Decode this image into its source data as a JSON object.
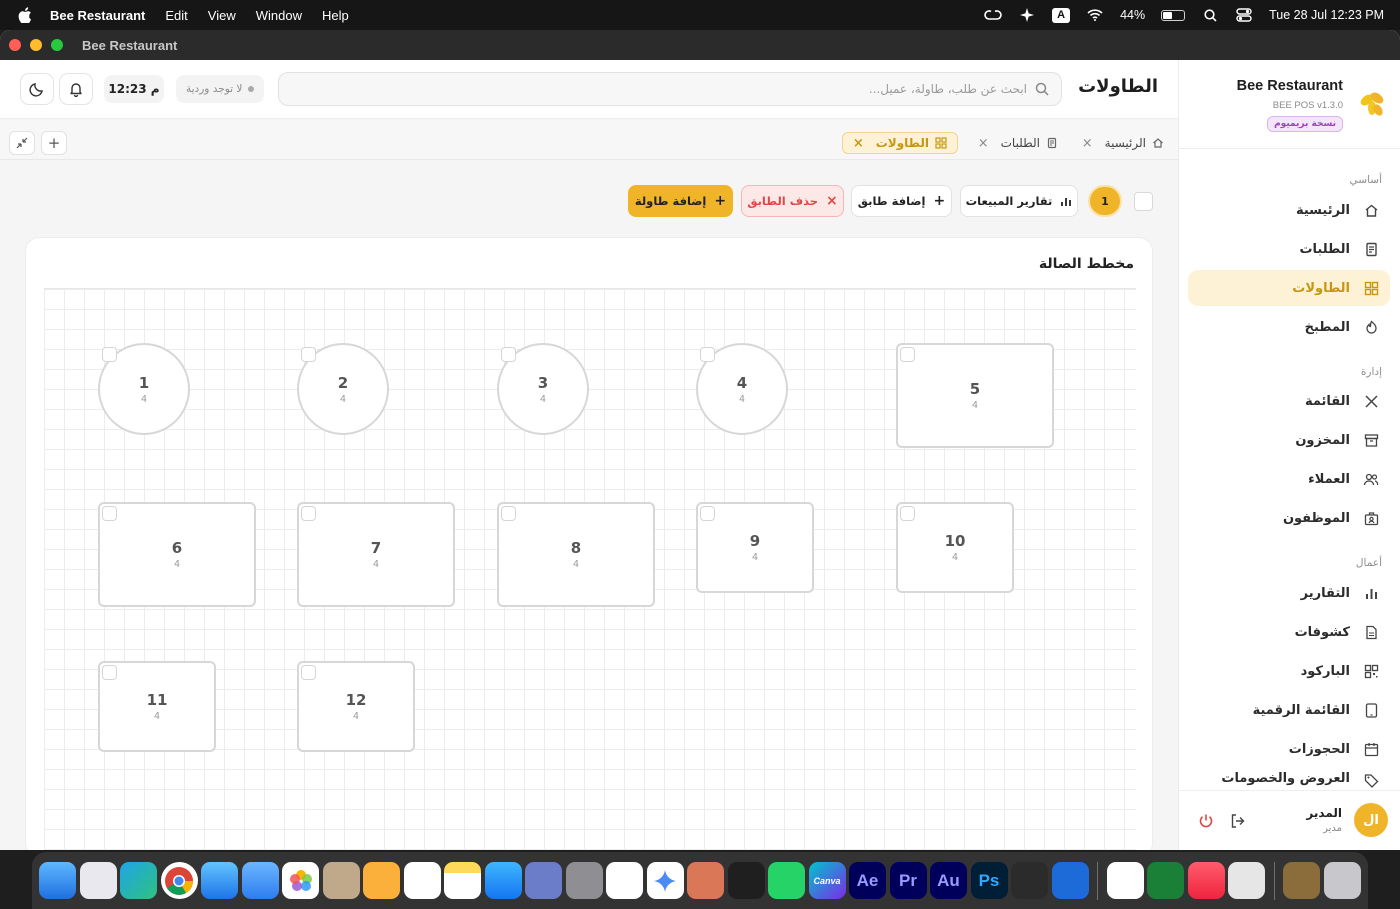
{
  "menubar": {
    "app": "Bee Restaurant",
    "items": [
      "Edit",
      "View",
      "Window",
      "Help"
    ],
    "battery": "44%",
    "datetime": "Tue 28 Jul  12:23 PM",
    "kbd": "A"
  },
  "window": {
    "title": "Bee Restaurant"
  },
  "sidebar": {
    "brand_name": "Bee Restaurant",
    "version": "BEE POS v1.3.0",
    "premium": "نسخة بريميوم",
    "sections": {
      "basic": "أساسي",
      "admin": "إدارة",
      "business": "أعمال"
    },
    "items": [
      {
        "label": "الرئيسية",
        "icon": "home-icon"
      },
      {
        "label": "الطلبات",
        "icon": "receipt-icon"
      },
      {
        "label": "الطاولات",
        "icon": "grid-icon",
        "active": true
      },
      {
        "label": "المطبخ",
        "icon": "chef-icon"
      },
      {
        "label": "القائمة",
        "icon": "utensils-icon"
      },
      {
        "label": "المخزون",
        "icon": "archive-icon"
      },
      {
        "label": "العملاء",
        "icon": "users-icon"
      },
      {
        "label": "الموظفون",
        "icon": "id-badge-icon"
      },
      {
        "label": "التقارير",
        "icon": "bar-chart-icon"
      },
      {
        "label": "كشوفات",
        "icon": "file-icon"
      },
      {
        "label": "الباركود",
        "icon": "qr-icon"
      },
      {
        "label": "القائمة الرقمية",
        "icon": "tablet-icon"
      },
      {
        "label": "الحجوزات",
        "icon": "calendar-icon"
      },
      {
        "label": "العروض والخصومات",
        "icon": "tag-icon"
      }
    ],
    "user": {
      "initials": "ال",
      "name": "المدير",
      "role": "مدير"
    }
  },
  "header": {
    "title": "الطاولات",
    "search_placeholder": "ابحث عن طلب، طاولة، عميل...",
    "shift": "لا توجد وردية",
    "clock": "12:23 م"
  },
  "tabs": [
    {
      "label": "الرئيسية"
    },
    {
      "label": "الطلبات"
    },
    {
      "label": "الطاولات",
      "active": true
    }
  ],
  "toolbar": {
    "sales_reports": "تقارير المبيعات",
    "add_floor": "إضافة طابق",
    "delete_floor": "حذف الطابق",
    "add_table": "إضافة طاولة",
    "floor": "1"
  },
  "floor_plan": {
    "title": "مخطط الصالة",
    "tables": [
      {
        "number": "1",
        "seats": "4",
        "shape": "round"
      },
      {
        "number": "2",
        "seats": "4",
        "shape": "round"
      },
      {
        "number": "3",
        "seats": "4",
        "shape": "round"
      },
      {
        "number": "4",
        "seats": "4",
        "shape": "round"
      },
      {
        "number": "5",
        "seats": "4",
        "shape": "rect"
      },
      {
        "number": "6",
        "seats": "4",
        "shape": "rect"
      },
      {
        "number": "7",
        "seats": "4",
        "shape": "rect"
      },
      {
        "number": "8",
        "seats": "4",
        "shape": "rect"
      },
      {
        "number": "9",
        "seats": "4",
        "shape": "rect"
      },
      {
        "number": "10",
        "seats": "4",
        "shape": "rect"
      },
      {
        "number": "11",
        "seats": "4",
        "shape": "rect"
      },
      {
        "number": "12",
        "seats": "4",
        "shape": "rect"
      }
    ]
  },
  "dock": {
    "apps": [
      "Finder",
      "Launchpad",
      "Edge",
      "Chrome",
      "Safari",
      "Mail",
      "Photos",
      "Contacts",
      "Pages",
      "Reminders",
      "Notes",
      "App Store",
      "Simulator",
      "System Settings",
      "ChatGPT",
      "Gemini",
      "Claude",
      "VS Code",
      "WhatsApp",
      "Canva",
      "Ae",
      "Pr",
      "Au",
      "Ps",
      "DaVinci",
      "QuickTime",
      "Calendar",
      "Numbers",
      "Music",
      "Bee",
      "Archive",
      "Trash"
    ],
    "canva": "Canva",
    "ae": "Ae",
    "pr": "Pr",
    "au": "Au",
    "ps": "Ps"
  },
  "colors": {
    "accent": "#f0b429",
    "danger": "#e04848"
  }
}
